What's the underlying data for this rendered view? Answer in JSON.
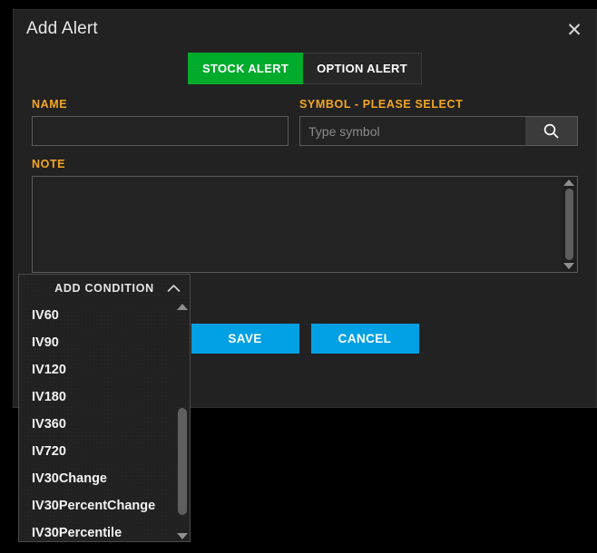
{
  "modal": {
    "title": "Add Alert",
    "close_label": "✕",
    "close_icon": "close-icon"
  },
  "tabs": [
    {
      "label": "STOCK ALERT",
      "active": true
    },
    {
      "label": "OPTION ALERT",
      "active": false
    }
  ],
  "form": {
    "name": {
      "label": "NAME",
      "value": "",
      "placeholder": ""
    },
    "symbol": {
      "label": "SYMBOL - PLEASE SELECT",
      "value": "",
      "placeholder": "Type symbol",
      "search_icon": "search-icon"
    },
    "note": {
      "label": "NOTE",
      "value": "",
      "placeholder": ""
    }
  },
  "actions": {
    "save_label": "SAVE",
    "cancel_label": "CANCEL"
  },
  "condition_dropdown": {
    "header_label": "ADD CONDITION",
    "chevron_icon": "chevron-up-icon",
    "items": [
      {
        "label": "IV60"
      },
      {
        "label": "IV90"
      },
      {
        "label": "IV120"
      },
      {
        "label": "IV180"
      },
      {
        "label": "IV360"
      },
      {
        "label": "IV720"
      },
      {
        "label": "IV30Change"
      },
      {
        "label": "IV30PercentChange"
      },
      {
        "label": "IV30Percentile"
      }
    ]
  },
  "colors": {
    "accent_green": "#00aa2b",
    "accent_blue": "#00a1e4",
    "label_orange": "#f5a623",
    "modal_bg": "#222222",
    "page_bg": "#000000"
  }
}
